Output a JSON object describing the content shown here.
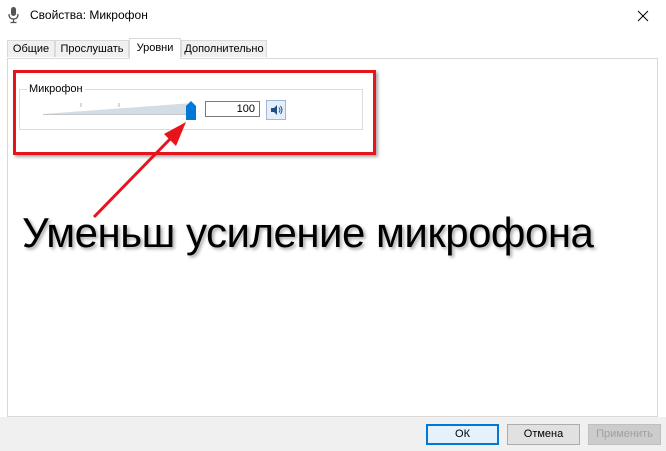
{
  "window": {
    "title": "Свойства: Микрофон",
    "icon": "microphone-icon",
    "close_icon": "close-icon"
  },
  "tabs": [
    {
      "label": "Общие",
      "active": false
    },
    {
      "label": "Прослушать",
      "active": false
    },
    {
      "label": "Уровни",
      "active": true
    },
    {
      "label": "Дополнительно",
      "active": false
    }
  ],
  "levels": {
    "group_label": "Микрофон",
    "value": "100",
    "slider_value_percent": 100,
    "mute_icon": "speaker-icon"
  },
  "annotation": {
    "text": "Уменьш усиление микрофона",
    "color": "#e8141b"
  },
  "buttons": {
    "ok": "ОК",
    "cancel": "Отмена",
    "apply": "Применить"
  },
  "colors": {
    "accent": "#0078d7",
    "annotation_red": "#e8141b"
  }
}
